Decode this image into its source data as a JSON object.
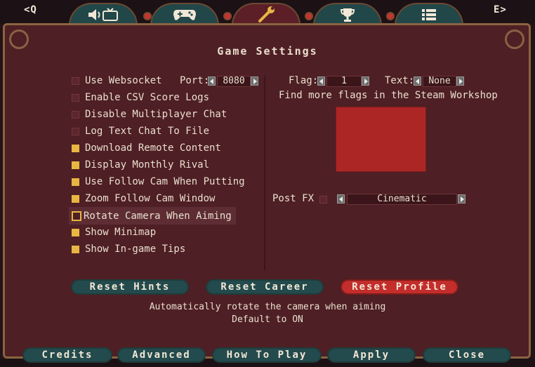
{
  "tabs": {
    "left_key": "<Q",
    "right_key": "E>",
    "items": [
      {
        "icon": "audio-video-icon"
      },
      {
        "icon": "gamepad-icon"
      },
      {
        "icon": "wrench-icon",
        "active": true
      },
      {
        "icon": "trophy-icon"
      },
      {
        "icon": "list-icon"
      }
    ]
  },
  "title": "Game Settings",
  "options": [
    {
      "label": "Use Websocket",
      "checked": false
    },
    {
      "label": "Enable CSV Score Logs",
      "checked": false
    },
    {
      "label": "Disable Multiplayer Chat",
      "checked": false
    },
    {
      "label": "Log Text Chat To File",
      "checked": false
    },
    {
      "label": "Download Remote Content",
      "checked": true
    },
    {
      "label": "Display Monthly Rival",
      "checked": true
    },
    {
      "label": "Use Follow Cam When Putting",
      "checked": true
    },
    {
      "label": "Zoom Follow Cam Window",
      "checked": true
    },
    {
      "label": "Rotate Camera When Aiming",
      "checked": false,
      "highlighted": true
    },
    {
      "label": "Show Minimap",
      "checked": true
    },
    {
      "label": "Show In-game Tips",
      "checked": true
    }
  ],
  "port": {
    "label": "Port:",
    "value": "8080"
  },
  "flag": {
    "label": "Flag:",
    "value": "1"
  },
  "text": {
    "label": "Text:",
    "value": "None"
  },
  "workshop_note": "Find more flags in the Steam Workshop",
  "flag_color": "#ac2626",
  "postfx": {
    "label": "Post FX",
    "value": "Cinematic"
  },
  "buttons": {
    "reset_hints": "Reset Hints",
    "reset_career": "Reset Career",
    "reset_profile": "Reset Profile"
  },
  "description": {
    "line1": "Automatically rotate the camera when aiming",
    "line2": "Default to ON"
  },
  "bottom": {
    "credits": "Credits",
    "advanced": "Advanced",
    "how_to_play": "How To Play",
    "apply": "Apply",
    "close": "Close"
  },
  "colors": {
    "panel": "#4e1f24",
    "accent_gold": "#e8b643",
    "teal_button": "#234a4c",
    "red_button": "#c32d2b"
  }
}
